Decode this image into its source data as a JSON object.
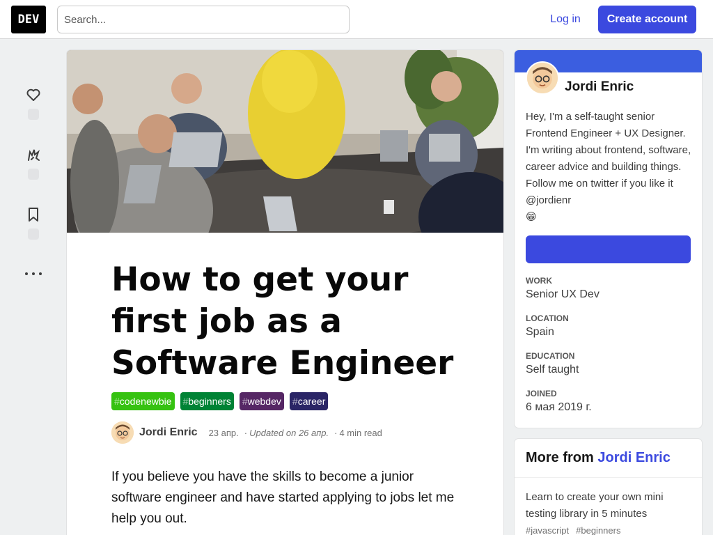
{
  "header": {
    "logo": "DEV",
    "search_placeholder": "Search...",
    "login_label": "Log in",
    "create_account_label": "Create account"
  },
  "reactions": {
    "like_icon": "heart-icon",
    "unicorn_icon": "unicorn-icon",
    "save_icon": "bookmark-icon",
    "more_icon": "more-dots-icon"
  },
  "article": {
    "title": "How to get your first job as a Software Engineer",
    "tags": [
      {
        "hash": "#",
        "name": "codenewbie",
        "color": "#36c211"
      },
      {
        "hash": "#",
        "name": "beginners",
        "color": "#008335"
      },
      {
        "hash": "#",
        "name": "webdev",
        "color": "#562765"
      },
      {
        "hash": "#",
        "name": "career",
        "color": "#2a2566"
      }
    ],
    "author": "Jordi Enric",
    "date": "23 апр.",
    "updated": "Updated on 26 апр.",
    "read_time": "4 min read",
    "intro": "If you believe you have the skills to become a junior software engineer and have started applying to jobs let me help you out."
  },
  "profile": {
    "name": "Jordi Enric",
    "bio": "Hey, I'm a self-taught senior Frontend Engineer + UX Designer. I'm writing about frontend, software, career advice and building things. Follow me on twitter if you like it @jordienr",
    "bio_emoji": "😁",
    "brand_color": "#3b5ee0",
    "work_label": "Work",
    "work": "Senior UX Dev",
    "location_label": "Location",
    "location": "Spain",
    "education_label": "Education",
    "education": "Self taught",
    "joined_label": "Joined",
    "joined": "6 мая 2019 г."
  },
  "more_from": {
    "prefix": "More from",
    "author": "Jordi Enric",
    "items": [
      {
        "title": "Learn to create your own mini testing library in 5 minutes",
        "tags": [
          "#javascript",
          "#beginners"
        ]
      }
    ]
  }
}
